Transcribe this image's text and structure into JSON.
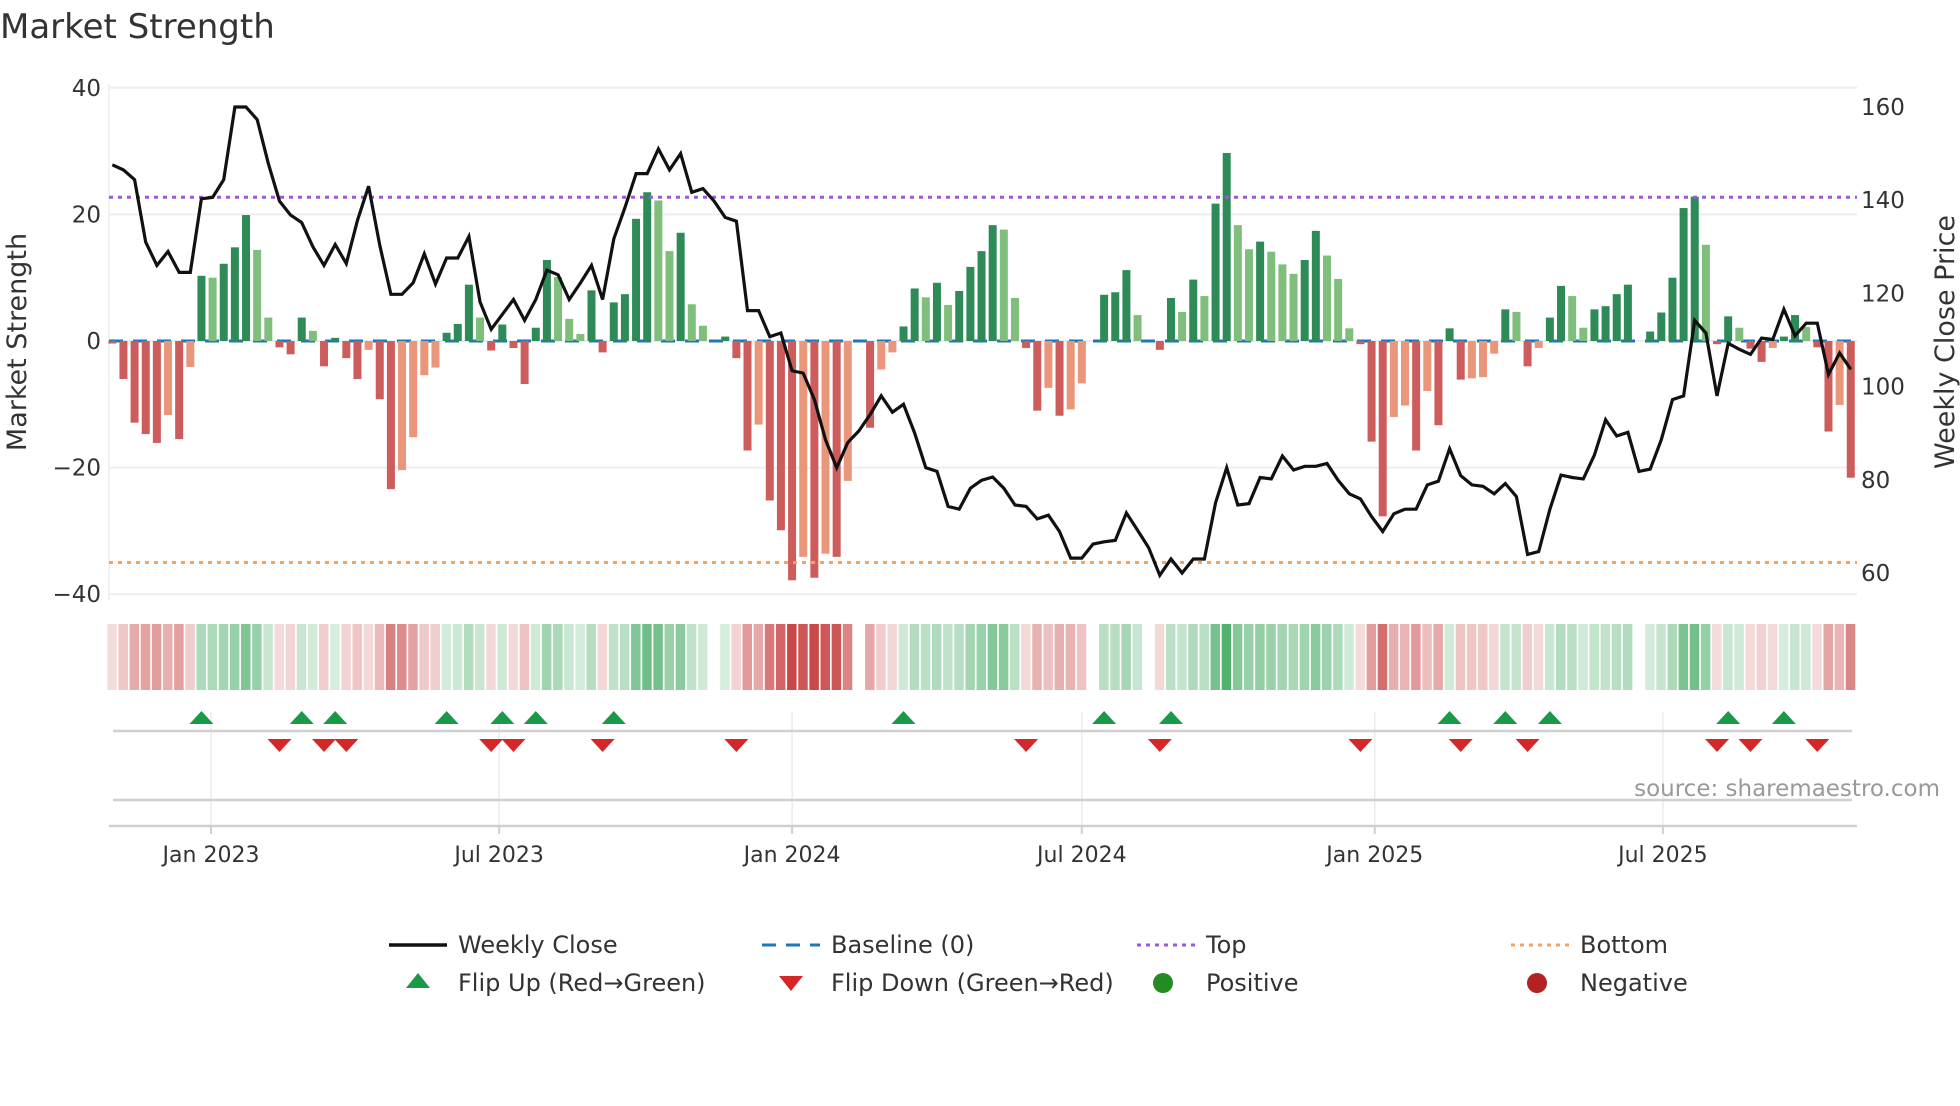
{
  "chart_data": {
    "type": "bar",
    "title": "Market Strength",
    "ylabel": "Market Strength",
    "y2label": "Weekly Close Price",
    "ylim": [
      -40,
      40
    ],
    "y2lim": [
      60,
      160
    ],
    "yticks": [
      "40",
      "20",
      "0",
      "−20",
      "−40"
    ],
    "ytick_values": [
      40,
      20,
      0,
      -20,
      -40
    ],
    "y2ticks": [
      "160",
      "140",
      "120",
      "100",
      "80",
      "60"
    ],
    "y2tick_values": [
      160,
      140,
      120,
      100,
      80,
      60
    ],
    "xticks": [
      {
        "label": "Jan 2023",
        "date": "2023-01-01"
      },
      {
        "label": "Jul 2023",
        "date": "2023-07-01"
      },
      {
        "label": "Jan 2024",
        "date": "2024-01-01"
      },
      {
        "label": "Jul 2024",
        "date": "2024-07-01"
      },
      {
        "label": "Jan 2025",
        "date": "2025-01-01"
      },
      {
        "label": "Jul 2025",
        "date": "2025-07-01"
      }
    ],
    "grid": true,
    "first_week": "2022-10-31",
    "frequency": "weekly",
    "strength": [
      -0.4,
      -6,
      -12.9,
      -14.7,
      -16.1,
      -11.7,
      -15.5,
      -4.1,
      10.3,
      10,
      12.2,
      14.8,
      19.9,
      14.4,
      3.7,
      -1,
      -2.1,
      3.7,
      1.6,
      -4,
      0.5,
      -2.7,
      -6,
      -1.4,
      -9.2,
      -23.4,
      -20.4,
      -15.2,
      -5.4,
      -4.2,
      1.3,
      2.7,
      8.9,
      3.7,
      -1.5,
      2.6,
      -1.1,
      -6.8,
      2.1,
      12.8,
      10.1,
      3.5,
      1.1,
      8,
      -1.8,
      6.1,
      7.4,
      19.3,
      23.5,
      22.2,
      14.2,
      17.1,
      5.8,
      2.4,
      0,
      0.7,
      -2.7,
      -17.3,
      -13.2,
      -25.2,
      -29.9,
      -37.8,
      -34.1,
      -37.4,
      -33.6,
      -34.1,
      -22.1,
      0,
      -13.7,
      -4.5,
      -1.8,
      2.3,
      8.3,
      6.9,
      9.2,
      5.7,
      7.9,
      11.7,
      14.2,
      18.3,
      17.6,
      6.8,
      -1.1,
      -11,
      -7.4,
      -11.8,
      -10.8,
      -6.7,
      0,
      7.3,
      7.7,
      11.2,
      4.1,
      0,
      -1.4,
      6.8,
      4.6,
      9.7,
      7.1,
      21.7,
      29.7,
      18.3,
      14.5,
      15.7,
      14.1,
      12.1,
      10.6,
      12.8,
      17.4,
      13.5,
      9.8,
      2,
      -0.5,
      -15.9,
      -27.7,
      -12,
      -10.2,
      -17.3,
      -7.9,
      -13.3,
      2,
      -6.1,
      -5.9,
      -5.7,
      -2,
      5,
      4.6,
      -4,
      -1.1,
      3.7,
      8.7,
      7.1,
      2.1,
      5,
      5.5,
      7.4,
      8.9,
      0,
      1.5,
      4.5,
      10,
      21,
      22.8,
      15.2,
      -0.5,
      3.9,
      2.1,
      -1.2,
      -3.3,
      -1.1,
      0.7,
      4.1,
      2.2,
      -1,
      -14.3,
      -10.1,
      -21.6
    ],
    "weekly_close": [
      147.6,
      146.5,
      144.4,
      131,
      126,
      129,
      124.5,
      124.5,
      140.3,
      140.6,
      144.4,
      160,
      160,
      157.3,
      147.9,
      139.8,
      136.8,
      135.2,
      130,
      126,
      130.5,
      126.4,
      135.7,
      143,
      130.3,
      119.8,
      119.8,
      122.3,
      128.5,
      122,
      127.6,
      127.6,
      132.2,
      118.2,
      112.3,
      115.5,
      118.7,
      114.2,
      118.7,
      125,
      124,
      118.7,
      122.2,
      126,
      118.7,
      131.7,
      138.4,
      145.7,
      145.7,
      151,
      146.5,
      150,
      141.7,
      142.5,
      139.8,
      136.3,
      135.5,
      116.3,
      116.3,
      110.7,
      111.5,
      103.4,
      102.9,
      97.2,
      88.6,
      82.6,
      88,
      90.5,
      94,
      98,
      94.5,
      96.2,
      90,
      82.6,
      81.8,
      74.3,
      73.7,
      78.2,
      79.9,
      80.6,
      78.2,
      74.6,
      74.3,
      71.6,
      72.4,
      68.9,
      63.2,
      63.2,
      66.2,
      66.7,
      67,
      72.9,
      69.2,
      65.4,
      59.5,
      63,
      60,
      63,
      63,
      75.1,
      82.6,
      74.6,
      74.9,
      80.5,
      80.2,
      85.1,
      82.1,
      82.9,
      82.9,
      83.5,
      79.9,
      77,
      75.9,
      72.1,
      68.9,
      72.7,
      73.7,
      73.7,
      78.9,
      79.7,
      86.7,
      80.9,
      78.9,
      78.6,
      77,
      79.2,
      76.4,
      64,
      64.6,
      73.7,
      81,
      80.5,
      80.2,
      85.3,
      92.9,
      89.4,
      90.2,
      81.8,
      82.3,
      88.6,
      97.2,
      98,
      114.2,
      111.5,
      98,
      109.3,
      108,
      106.9,
      110.4,
      110.1,
      116.6,
      110.9,
      113.6,
      113.6,
      102.6,
      107.2,
      103.7
    ],
    "top_level": 22.7,
    "bottom_level": -35,
    "baseline": 0,
    "flip_up_dates": [
      "2022-12-26",
      "2023-02-27",
      "2023-03-20",
      "2023-05-29",
      "2023-07-03",
      "2023-07-24",
      "2023-09-11",
      "2024-03-11",
      "2024-07-15",
      "2024-08-26",
      "2025-02-17",
      "2025-03-24",
      "2025-04-21",
      "2025-08-11",
      "2025-09-15"
    ],
    "flip_down_dates": [
      "2023-02-13",
      "2023-03-13",
      "2023-03-27",
      "2023-06-26",
      "2023-07-10",
      "2023-09-04",
      "2023-11-27",
      "2024-05-27",
      "2024-08-19",
      "2024-12-23",
      "2025-02-24",
      "2025-04-07",
      "2025-08-04",
      "2025-08-25",
      "2025-10-06"
    ],
    "legend_position": "bottom",
    "legend": [
      {
        "label": "Weekly Close",
        "kind": "line"
      },
      {
        "label": "Baseline (0)",
        "kind": "dash"
      },
      {
        "label": "Top",
        "kind": "dot-top"
      },
      {
        "label": "Bottom",
        "kind": "dot-bottom"
      },
      {
        "label": "Flip Up (Red→Green)",
        "kind": "tri-up"
      },
      {
        "label": "Flip Down (Green→Red)",
        "kind": "tri-down"
      },
      {
        "label": "Positive",
        "kind": "circle-pos"
      },
      {
        "label": "Negative",
        "kind": "circle-neg"
      }
    ],
    "source": "source: sharemaestro.com"
  },
  "colors": {
    "green_rising": "#2e8b57",
    "green_falling": "#7fbf7b",
    "red_falling": "#cd5c5c",
    "red_recovering": "#e9967a",
    "price_line": "#111111",
    "baseline": "#1f77b4",
    "top": "#9b59d6",
    "bottom": "#f4a460",
    "flip_up": "#1a9a48",
    "flip_down": "#d62728",
    "positive": "#228b22",
    "negative": "#b22222",
    "heat_green": [
      46,
      160,
      80
    ],
    "heat_red": [
      200,
      70,
      70
    ]
  }
}
